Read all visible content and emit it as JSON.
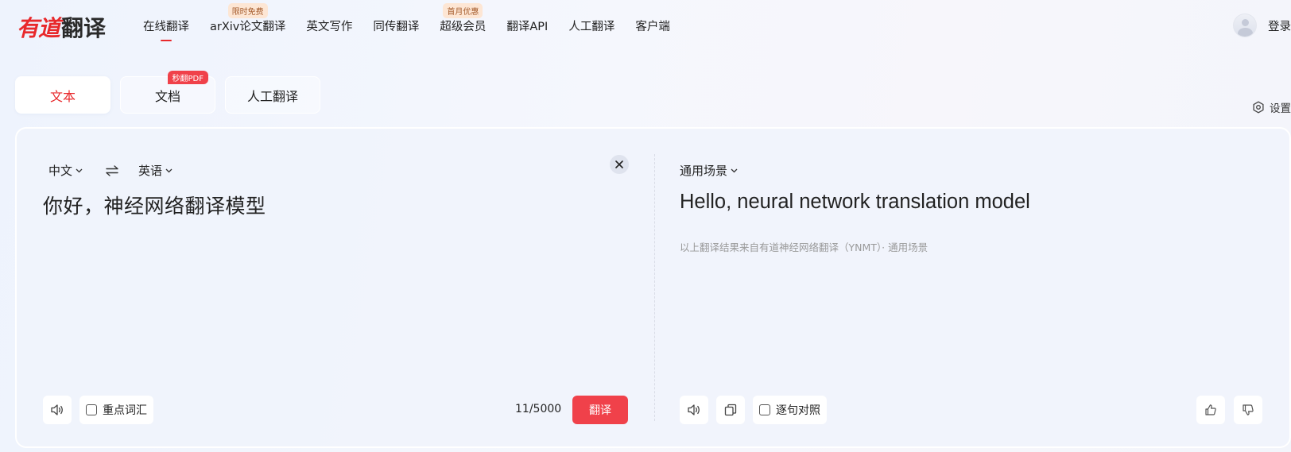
{
  "logo": {
    "brand": "有道",
    "product": "翻译"
  },
  "nav": {
    "items": [
      {
        "label": "在线翻译",
        "active": true,
        "badge": ""
      },
      {
        "label": "arXiv论文翻译",
        "active": false,
        "badge": "限时免费"
      },
      {
        "label": "英文写作",
        "active": false,
        "badge": ""
      },
      {
        "label": "同传翻译",
        "active": false,
        "badge": ""
      },
      {
        "label": "超级会员",
        "active": false,
        "badge": "首月优惠"
      },
      {
        "label": "翻译API",
        "active": false,
        "badge": ""
      },
      {
        "label": "人工翻译",
        "active": false,
        "badge": ""
      },
      {
        "label": "客户端",
        "active": false,
        "badge": ""
      }
    ]
  },
  "user": {
    "login_label": "登录"
  },
  "tabs": [
    {
      "label": "文本",
      "active": true,
      "badge": ""
    },
    {
      "label": "文档",
      "active": false,
      "badge": "秒翻PDF"
    },
    {
      "label": "人工翻译",
      "active": false,
      "badge": ""
    }
  ],
  "settings_label": "设置",
  "source": {
    "from_lang": "中文",
    "to_lang": "英语",
    "text": "你好，神经网络翻译模型",
    "key_vocab_label": "重点词汇",
    "char_count": "11/5000",
    "translate_label": "翻译"
  },
  "target": {
    "scene": "通用场景",
    "result": "Hello, neural network translation model",
    "note": "以上翻译结果来自有道神经网络翻译（YNMT）· 通用场景",
    "sentence_compare_label": "逐句对照"
  },
  "colors": {
    "accent": "#e8282b",
    "button": "#f0414a"
  }
}
